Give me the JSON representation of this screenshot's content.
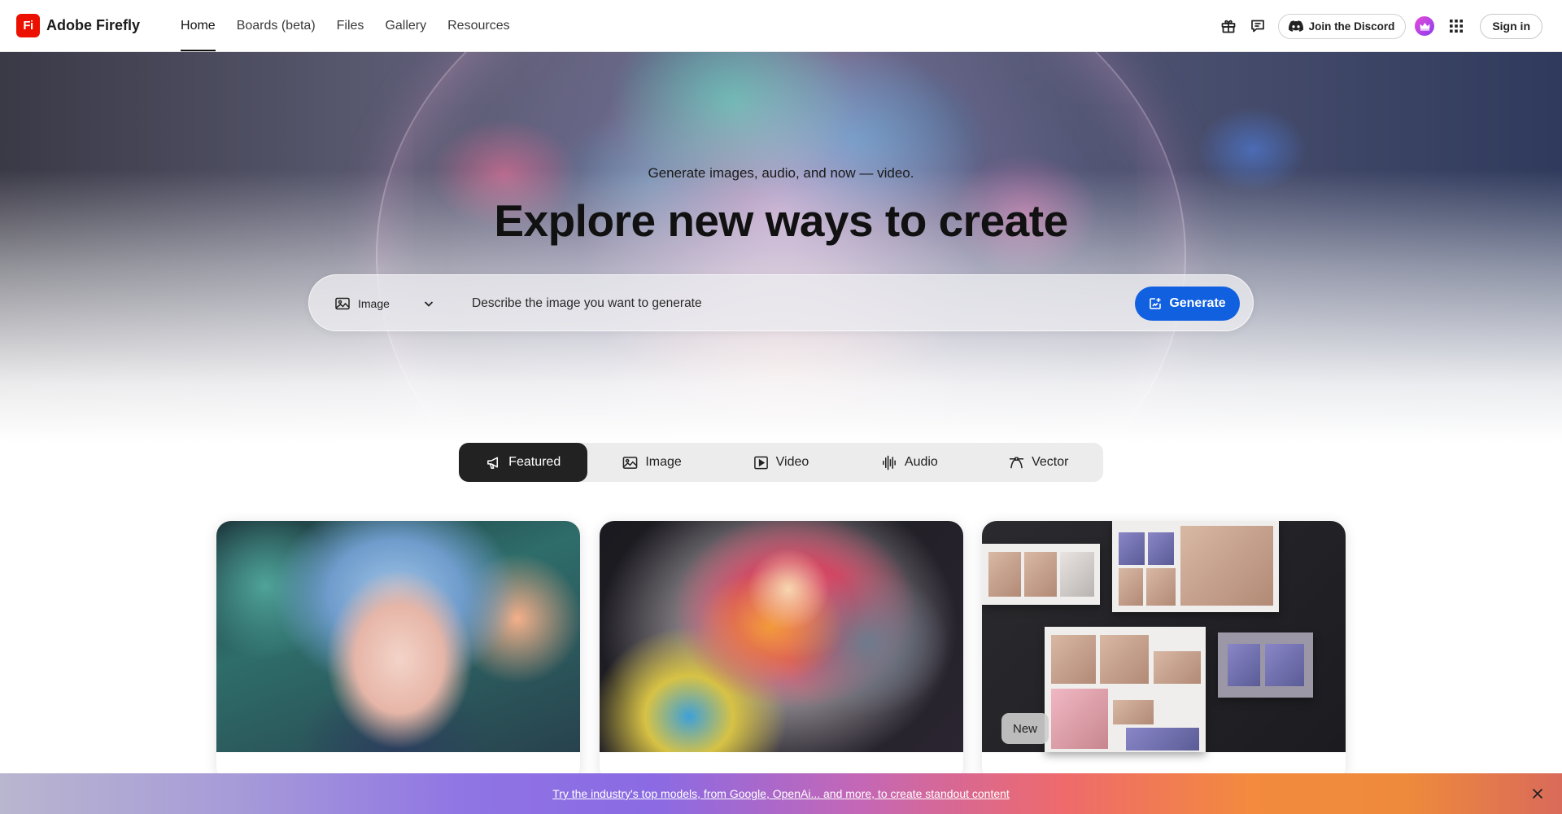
{
  "brand": {
    "logo_text": "Fi",
    "name": "Adobe Firefly",
    "logo_color": "#eb1000"
  },
  "nav": {
    "links": [
      {
        "label": "Home",
        "active": true
      },
      {
        "label": "Boards (beta)",
        "active": false
      },
      {
        "label": "Files",
        "active": false
      },
      {
        "label": "Gallery",
        "active": false
      },
      {
        "label": "Resources",
        "active": false
      }
    ],
    "icons": [
      "gift-icon",
      "chat-icon"
    ],
    "discord_label": "Join the Discord",
    "signin_label": "Sign in"
  },
  "hero": {
    "subtitle": "Generate images, audio, and now — video.",
    "title": "Explore new ways to create",
    "prompt": {
      "type_label": "Image",
      "placeholder": "Describe the image you want to generate",
      "generate_label": "Generate",
      "accent": "#1160e0"
    }
  },
  "categories": [
    {
      "label": "Featured",
      "icon": "megaphone-icon",
      "active": true
    },
    {
      "label": "Image",
      "icon": "image-icon",
      "active": false
    },
    {
      "label": "Video",
      "icon": "video-icon",
      "active": false
    },
    {
      "label": "Audio",
      "icon": "audio-waveform-icon",
      "active": false
    },
    {
      "label": "Vector",
      "icon": "vector-pen-icon",
      "active": false
    }
  ],
  "cards": [
    {
      "name": "anime-portrait-card"
    },
    {
      "name": "parrot-card"
    },
    {
      "name": "moodboard-card",
      "badge": "New"
    }
  ],
  "banner": {
    "text": "Try the industry's top models, from Google, OpenAi... and more, to create standout content"
  }
}
